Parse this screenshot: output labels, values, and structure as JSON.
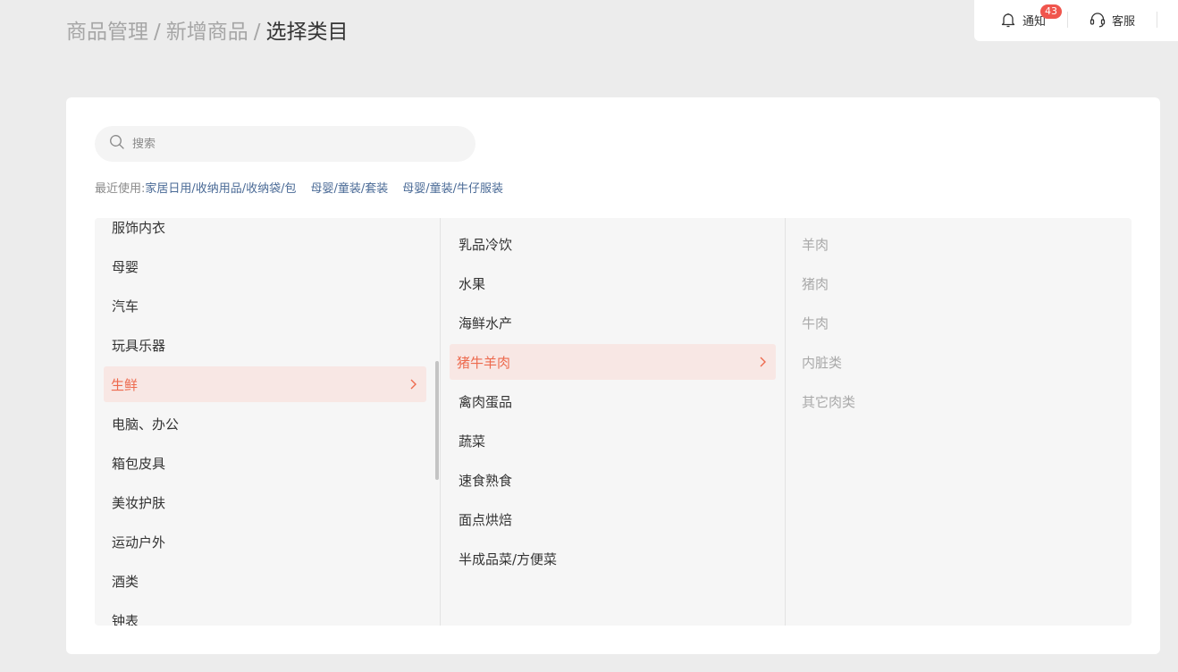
{
  "breadcrumb": {
    "items": [
      "商品管理",
      "新增商品"
    ],
    "separator": "/",
    "current": "选择类目"
  },
  "header": {
    "notify_label": "通知",
    "notify_badge": "43",
    "service_label": "客服"
  },
  "search": {
    "placeholder": "搜索",
    "value": ""
  },
  "recent": {
    "label": "最近使用:",
    "links": [
      "家居日用/收纳用品/收纳袋/包",
      "母婴/童装/套装",
      "母婴/童装/牛仔服装"
    ]
  },
  "columns": {
    "level1": [
      "服饰内衣",
      "母婴",
      "汽车",
      "玩具乐器",
      "生鲜",
      "电脑、办公",
      "箱包皮具",
      "美妆护肤",
      "运动户外",
      "酒类",
      "钟表"
    ],
    "level2": [
      "乳品冷饮",
      "水果",
      "海鲜水产",
      "猪牛羊肉",
      "禽肉蛋品",
      "蔬菜",
      "速食熟食",
      "面点烘焙",
      "半成品菜/方便菜"
    ],
    "level3": [
      "羊肉",
      "猪肉",
      "牛肉",
      "内脏类",
      "其它肉类"
    ]
  },
  "colors": {
    "accent": "#ed6a4e",
    "active_bg": "#f8e7e4",
    "badge": "#f0554d",
    "link": "#4a6a96"
  },
  "icons": {
    "notify": "bell-icon",
    "service": "headset-icon",
    "search": "search-icon",
    "chevron": "chevron-right-icon"
  }
}
